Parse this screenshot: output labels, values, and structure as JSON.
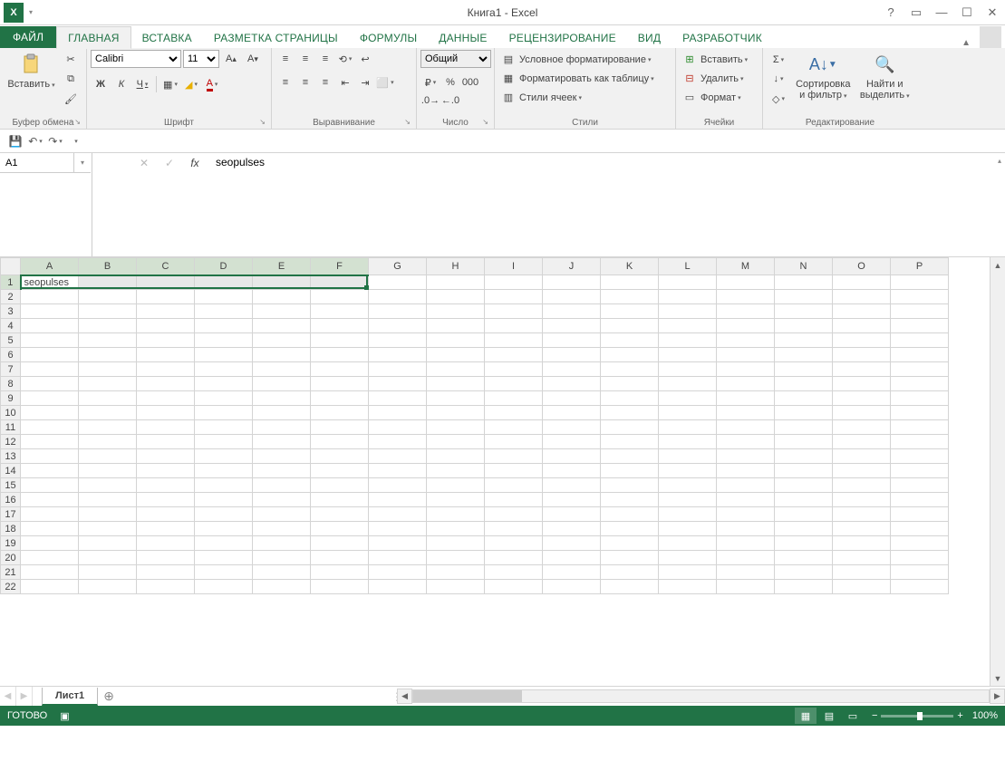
{
  "title": "Книга1 - Excel",
  "tabs": {
    "file": "ФАЙЛ",
    "home": "ГЛАВНАЯ",
    "insert": "ВСТАВКА",
    "layout": "РАЗМЕТКА СТРАНИЦЫ",
    "formulas": "ФОРМУЛЫ",
    "data": "ДАННЫЕ",
    "review": "РЕЦЕНЗИРОВАНИЕ",
    "view": "ВИД",
    "developer": "РАЗРАБОТЧИК"
  },
  "ribbon": {
    "clipboard": {
      "label": "Буфер обмена",
      "paste": "Вставить"
    },
    "font": {
      "label": "Шрифт",
      "name": "Calibri",
      "size": "11",
      "bold": "Ж",
      "italic": "К",
      "underline": "Ч"
    },
    "alignment": {
      "label": "Выравнивание"
    },
    "number": {
      "label": "Число",
      "format": "Общий"
    },
    "styles": {
      "label": "Стили",
      "cond": "Условное форматирование",
      "table": "Форматировать как таблицу",
      "cell": "Стили ячеек"
    },
    "cells": {
      "label": "Ячейки",
      "insert": "Вставить",
      "delete": "Удалить",
      "format": "Формат"
    },
    "editing": {
      "label": "Редактирование",
      "sort": "Сортировка и фильтр",
      "find": "Найти и выделить"
    }
  },
  "formula": {
    "cellref": "A1",
    "text": "seopulses",
    "fx": "fx"
  },
  "grid": {
    "cols": [
      "A",
      "B",
      "C",
      "D",
      "E",
      "F",
      "G",
      "H",
      "I",
      "J",
      "K",
      "L",
      "M",
      "N",
      "O",
      "P"
    ],
    "rows": 22,
    "selected_cols": [
      "A",
      "B",
      "C",
      "D",
      "E",
      "F"
    ],
    "selected_row": 1,
    "active_cell": "A1",
    "cells": {
      "A1": "seopulses"
    }
  },
  "sheets": {
    "active": "Лист1"
  },
  "statusbar": {
    "ready": "ГОТОВО",
    "zoom": "100%"
  }
}
